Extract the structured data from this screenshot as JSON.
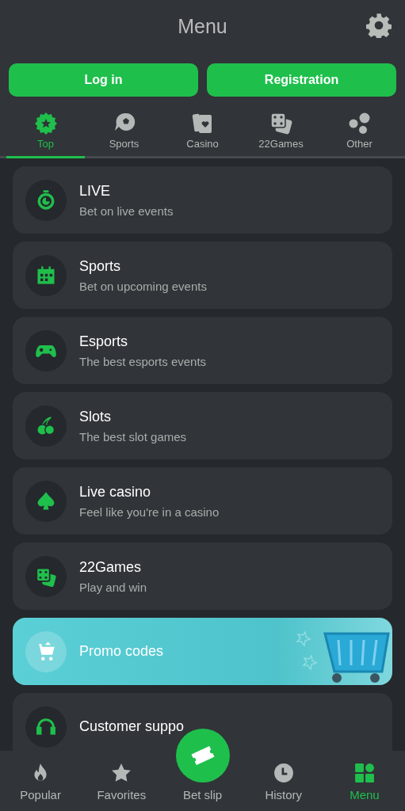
{
  "header": {
    "title": "Menu"
  },
  "auth_buttons": [
    "Log in",
    "Registration"
  ],
  "tabs": [
    {
      "label": "Top",
      "kind": "top",
      "selected": true
    },
    {
      "label": "Sports",
      "kind": "sports",
      "selected": false
    },
    {
      "label": "Casino",
      "kind": "casino",
      "selected": false
    },
    {
      "label": "22Games",
      "kind": "games",
      "selected": false
    },
    {
      "label": "Other",
      "kind": "other",
      "selected": false
    }
  ],
  "menu_items": [
    {
      "kind": "live",
      "title": "LIVE",
      "subtitle": "Bet on live events"
    },
    {
      "kind": "sports",
      "title": "Sports",
      "subtitle": "Bet on upcoming events"
    },
    {
      "kind": "esports",
      "title": "Esports",
      "subtitle": "The best esports events"
    },
    {
      "kind": "slots",
      "title": "Slots",
      "subtitle": "The best slot games"
    },
    {
      "kind": "casino",
      "title": "Live casino",
      "subtitle": "Feel like you're in a casino"
    },
    {
      "kind": "games",
      "title": "22Games",
      "subtitle": "Play and win"
    },
    {
      "kind": "promo",
      "title": "Promo codes"
    },
    {
      "kind": "support",
      "title": "Customer suppo"
    }
  ],
  "bottom_nav": [
    {
      "label": "Popular",
      "kind": "popular",
      "selected": false
    },
    {
      "label": "Favorites",
      "kind": "favorites",
      "selected": false
    },
    {
      "label": "Bet slip",
      "kind": "betslip",
      "selected": false
    },
    {
      "label": "History",
      "kind": "history",
      "selected": false
    },
    {
      "label": "Menu",
      "kind": "menu",
      "selected": true
    }
  ]
}
